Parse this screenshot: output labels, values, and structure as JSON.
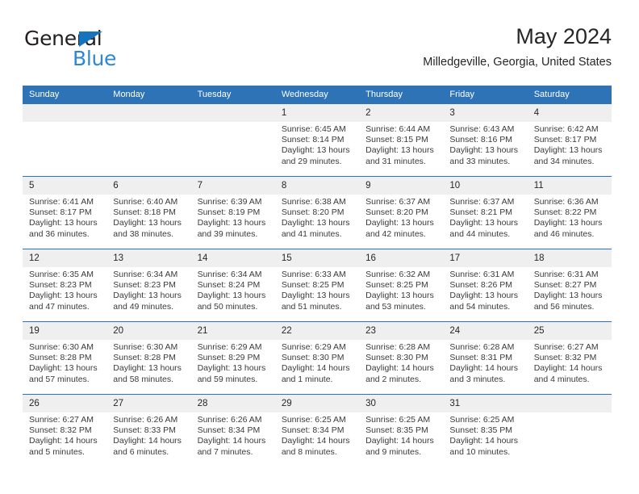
{
  "brand": {
    "name_part1": "General",
    "name_part2": "Blue",
    "accent_color": "#2e87d6",
    "triangle_color": "#1574bd"
  },
  "header": {
    "title": "May 2024",
    "subtitle": "Milledgeville, Georgia, United States",
    "header_bg_color": "#2e73b5",
    "daynum_bg_color": "#efefef"
  },
  "weekday_headers": [
    "Sunday",
    "Monday",
    "Tuesday",
    "Wednesday",
    "Thursday",
    "Friday",
    "Saturday"
  ],
  "labels": {
    "sunrise": "Sunrise:",
    "sunset": "Sunset:",
    "daylight": "Daylight:"
  },
  "weeks": [
    [
      {
        "day": "",
        "sunrise": "",
        "sunset": "",
        "daylight": ""
      },
      {
        "day": "",
        "sunrise": "",
        "sunset": "",
        "daylight": ""
      },
      {
        "day": "",
        "sunrise": "",
        "sunset": "",
        "daylight": ""
      },
      {
        "day": "1",
        "sunrise": "Sunrise: 6:45 AM",
        "sunset": "Sunset: 8:14 PM",
        "daylight": "Daylight: 13 hours and 29 minutes."
      },
      {
        "day": "2",
        "sunrise": "Sunrise: 6:44 AM",
        "sunset": "Sunset: 8:15 PM",
        "daylight": "Daylight: 13 hours and 31 minutes."
      },
      {
        "day": "3",
        "sunrise": "Sunrise: 6:43 AM",
        "sunset": "Sunset: 8:16 PM",
        "daylight": "Daylight: 13 hours and 33 minutes."
      },
      {
        "day": "4",
        "sunrise": "Sunrise: 6:42 AM",
        "sunset": "Sunset: 8:17 PM",
        "daylight": "Daylight: 13 hours and 34 minutes."
      }
    ],
    [
      {
        "day": "5",
        "sunrise": "Sunrise: 6:41 AM",
        "sunset": "Sunset: 8:17 PM",
        "daylight": "Daylight: 13 hours and 36 minutes."
      },
      {
        "day": "6",
        "sunrise": "Sunrise: 6:40 AM",
        "sunset": "Sunset: 8:18 PM",
        "daylight": "Daylight: 13 hours and 38 minutes."
      },
      {
        "day": "7",
        "sunrise": "Sunrise: 6:39 AM",
        "sunset": "Sunset: 8:19 PM",
        "daylight": "Daylight: 13 hours and 39 minutes."
      },
      {
        "day": "8",
        "sunrise": "Sunrise: 6:38 AM",
        "sunset": "Sunset: 8:20 PM",
        "daylight": "Daylight: 13 hours and 41 minutes."
      },
      {
        "day": "9",
        "sunrise": "Sunrise: 6:37 AM",
        "sunset": "Sunset: 8:20 PM",
        "daylight": "Daylight: 13 hours and 42 minutes."
      },
      {
        "day": "10",
        "sunrise": "Sunrise: 6:37 AM",
        "sunset": "Sunset: 8:21 PM",
        "daylight": "Daylight: 13 hours and 44 minutes."
      },
      {
        "day": "11",
        "sunrise": "Sunrise: 6:36 AM",
        "sunset": "Sunset: 8:22 PM",
        "daylight": "Daylight: 13 hours and 46 minutes."
      }
    ],
    [
      {
        "day": "12",
        "sunrise": "Sunrise: 6:35 AM",
        "sunset": "Sunset: 8:23 PM",
        "daylight": "Daylight: 13 hours and 47 minutes."
      },
      {
        "day": "13",
        "sunrise": "Sunrise: 6:34 AM",
        "sunset": "Sunset: 8:23 PM",
        "daylight": "Daylight: 13 hours and 49 minutes."
      },
      {
        "day": "14",
        "sunrise": "Sunrise: 6:34 AM",
        "sunset": "Sunset: 8:24 PM",
        "daylight": "Daylight: 13 hours and 50 minutes."
      },
      {
        "day": "15",
        "sunrise": "Sunrise: 6:33 AM",
        "sunset": "Sunset: 8:25 PM",
        "daylight": "Daylight: 13 hours and 51 minutes."
      },
      {
        "day": "16",
        "sunrise": "Sunrise: 6:32 AM",
        "sunset": "Sunset: 8:25 PM",
        "daylight": "Daylight: 13 hours and 53 minutes."
      },
      {
        "day": "17",
        "sunrise": "Sunrise: 6:31 AM",
        "sunset": "Sunset: 8:26 PM",
        "daylight": "Daylight: 13 hours and 54 minutes."
      },
      {
        "day": "18",
        "sunrise": "Sunrise: 6:31 AM",
        "sunset": "Sunset: 8:27 PM",
        "daylight": "Daylight: 13 hours and 56 minutes."
      }
    ],
    [
      {
        "day": "19",
        "sunrise": "Sunrise: 6:30 AM",
        "sunset": "Sunset: 8:28 PM",
        "daylight": "Daylight: 13 hours and 57 minutes."
      },
      {
        "day": "20",
        "sunrise": "Sunrise: 6:30 AM",
        "sunset": "Sunset: 8:28 PM",
        "daylight": "Daylight: 13 hours and 58 minutes."
      },
      {
        "day": "21",
        "sunrise": "Sunrise: 6:29 AM",
        "sunset": "Sunset: 8:29 PM",
        "daylight": "Daylight: 13 hours and 59 minutes."
      },
      {
        "day": "22",
        "sunrise": "Sunrise: 6:29 AM",
        "sunset": "Sunset: 8:30 PM",
        "daylight": "Daylight: 14 hours and 1 minute."
      },
      {
        "day": "23",
        "sunrise": "Sunrise: 6:28 AM",
        "sunset": "Sunset: 8:30 PM",
        "daylight": "Daylight: 14 hours and 2 minutes."
      },
      {
        "day": "24",
        "sunrise": "Sunrise: 6:28 AM",
        "sunset": "Sunset: 8:31 PM",
        "daylight": "Daylight: 14 hours and 3 minutes."
      },
      {
        "day": "25",
        "sunrise": "Sunrise: 6:27 AM",
        "sunset": "Sunset: 8:32 PM",
        "daylight": "Daylight: 14 hours and 4 minutes."
      }
    ],
    [
      {
        "day": "26",
        "sunrise": "Sunrise: 6:27 AM",
        "sunset": "Sunset: 8:32 PM",
        "daylight": "Daylight: 14 hours and 5 minutes."
      },
      {
        "day": "27",
        "sunrise": "Sunrise: 6:26 AM",
        "sunset": "Sunset: 8:33 PM",
        "daylight": "Daylight: 14 hours and 6 minutes."
      },
      {
        "day": "28",
        "sunrise": "Sunrise: 6:26 AM",
        "sunset": "Sunset: 8:34 PM",
        "daylight": "Daylight: 14 hours and 7 minutes."
      },
      {
        "day": "29",
        "sunrise": "Sunrise: 6:25 AM",
        "sunset": "Sunset: 8:34 PM",
        "daylight": "Daylight: 14 hours and 8 minutes."
      },
      {
        "day": "30",
        "sunrise": "Sunrise: 6:25 AM",
        "sunset": "Sunset: 8:35 PM",
        "daylight": "Daylight: 14 hours and 9 minutes."
      },
      {
        "day": "31",
        "sunrise": "Sunrise: 6:25 AM",
        "sunset": "Sunset: 8:35 PM",
        "daylight": "Daylight: 14 hours and 10 minutes."
      },
      {
        "day": "",
        "sunrise": "",
        "sunset": "",
        "daylight": ""
      }
    ]
  ]
}
